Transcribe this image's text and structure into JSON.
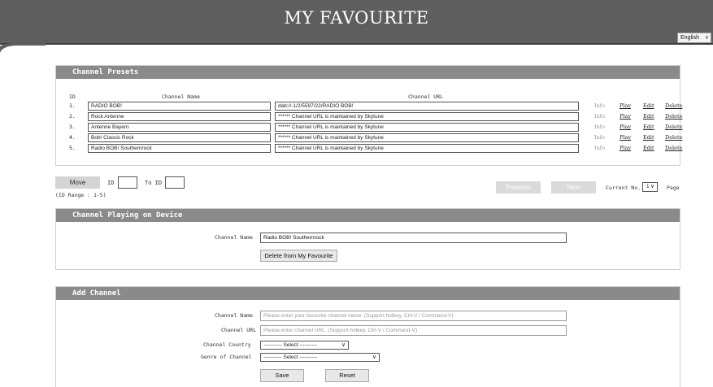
{
  "header": {
    "title": "MY FAVOURITE",
    "language": "English"
  },
  "presets": {
    "heading": "Channel Presets",
    "col_id": "ID",
    "col_name": "Channel Name",
    "col_url": "Channel URL",
    "rows": [
      {
        "id": "1.",
        "name": "RADIO BOB!",
        "url": "dab://-1/2/5597/22/RADIO BOB!"
      },
      {
        "id": "2.",
        "name": "Rock Antenne",
        "url": "****** Channel URL is maintained by Skytune"
      },
      {
        "id": "3.",
        "name": "Antenne Bayern",
        "url": "****** Channel URL is maintained by Skytune"
      },
      {
        "id": "4.",
        "name": "Bob! Classic Rock",
        "url": "****** Channel URL is maintained by Skytune"
      },
      {
        "id": "5.",
        "name": "Radio BOB! Southernrock",
        "url": "****** Channel URL is maintained by Skytune"
      }
    ],
    "actions": {
      "info": "Info",
      "play": "Play",
      "edit": "Edit",
      "delete": "Delete"
    }
  },
  "move": {
    "button": "Move",
    "id_label": "ID",
    "to_label": "To ID",
    "range": "(ID Range : 1-5)",
    "previous": "Previous",
    "next": "Next",
    "current_label": "Current No.",
    "current_value": "1",
    "page_label": "Page"
  },
  "playing": {
    "heading": "Channel Playing on Device",
    "name_label": "Channel Name",
    "name_value": "Radio BOB! Southernrock",
    "delete_button": "Delete from My Favourite"
  },
  "add": {
    "heading": "Add Channel",
    "name_label": "Channel Name",
    "name_placeholder": "Please enter your favourite channel name. (Support hotkey, Ctrl-V / Command-V)",
    "url_label": "Channel URL",
    "url_placeholder": "Please enter channel URL. (Support hotkey, Ctrl-V / Command-V)",
    "country_label": "Channel Country",
    "country_value": "---------- Select ----------",
    "genre_label": "Genre of Channel",
    "genre_value": "---------- Select ----------",
    "save": "Save",
    "reset": "Reset"
  }
}
